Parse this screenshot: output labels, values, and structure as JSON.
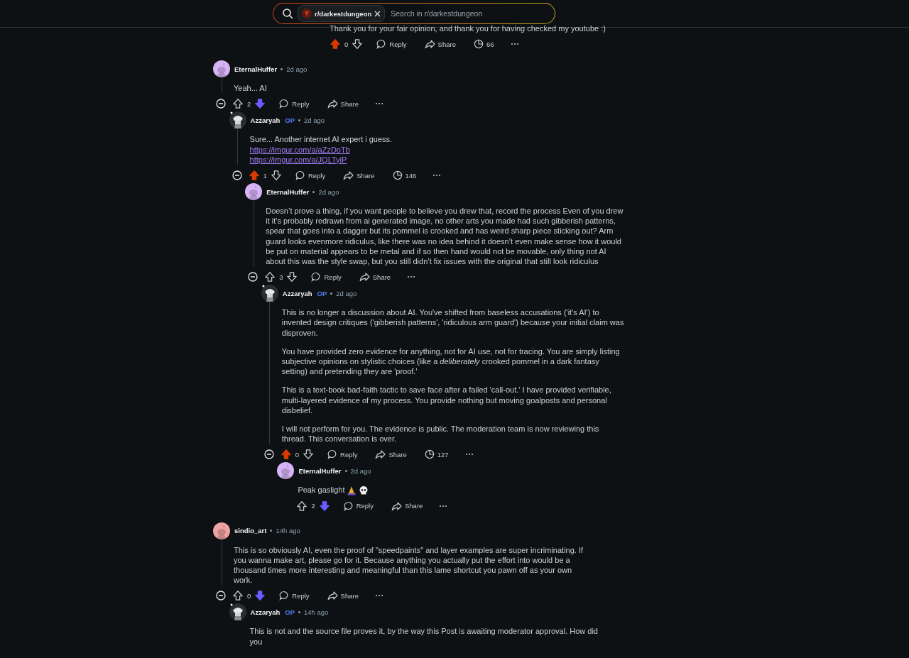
{
  "search": {
    "community": "r/darkestdungeon",
    "placeholder": "Search in r/darkestdungeon"
  },
  "fragment": {
    "body": [
      {
        "kind": "text",
        "text": "Thank you for your fair opinion, and thank you for having checked my youtube :)"
      }
    ],
    "upvoted": true,
    "downvoted": false,
    "score": "0",
    "reply_label": "Reply",
    "share_label": "Share",
    "views": "66"
  },
  "comments": [
    {
      "author": "EternalHuffer",
      "op": false,
      "time": "2d ago",
      "avatar": {
        "kind": "snoo",
        "color": "#d6b4f7"
      },
      "body": [
        {
          "kind": "text",
          "text": "Yeah... AI"
        }
      ],
      "upvoted": false,
      "downvoted": true,
      "score": "2",
      "reply_label": "Reply",
      "share_label": "Share",
      "children": [
        {
          "author": "Azzaryah",
          "op": true,
          "op_label": "OP",
          "time": "2d ago",
          "avatar": {
            "kind": "drawing"
          },
          "body": [
            {
              "kind": "text",
              "text": "Sure... Another internet AI expert i guess."
            },
            {
              "kind": "link",
              "text": "https://imgur.com/a/aZzDoTb"
            },
            {
              "kind": "link",
              "text": "https://imgur.com/a/JQLTyiP"
            }
          ],
          "upvoted": true,
          "downvoted": false,
          "score": "1",
          "reply_label": "Reply",
          "share_label": "Share",
          "views": "146",
          "children": [
            {
              "author": "EternalHuffer",
              "op": false,
              "time": "2d ago",
              "avatar": {
                "kind": "snoo",
                "color": "#d6b4f7"
              },
              "body": [
                {
                  "kind": "text",
                  "text": "Doesn’t prove a thing, if you want people to believe you drew that, record the process Even of you drew it it’s probably redrawn from ai generated image, no other arts you made had such gibberish patterns, spear that goes into a dagger but its pommel is crooked and has weird sharp piece sticking out? Arm guard looks evenmore ridiculus, like there was no idea behind it doesn’t even make sense how it would be put on material appears to be metal and if so then hand would not be movable, only thing not AI about this was the style swap, but you still didn’t fix issues with the original that still look ridiculus"
                }
              ],
              "upvoted": false,
              "downvoted": false,
              "score": "3",
              "reply_label": "Reply",
              "share_label": "Share",
              "children": [
                {
                  "author": "Azzaryah",
                  "op": true,
                  "op_label": "OP",
                  "time": "2d ago",
                  "avatar": {
                    "kind": "drawing"
                  },
                  "body": [
                    {
                      "kind": "text",
                      "text": "This is no longer a discussion about AI. You've shifted from baseless accusations ('it's AI') to invented design critiques ('gibberish patterns', 'ridiculous arm guard') because your initial claim was disproven."
                    },
                    {
                      "kind": "text",
                      "text": "You have provided zero evidence for anything, not for AI use, not for tracing. You are simply listing subjective opinions on stylistic choices (like a *deliberately* crooked pommel in a dark fantasy setting) and pretending they are 'proof.'"
                    },
                    {
                      "kind": "text",
                      "text": "This is a text-book bad-faith tactic to save face after a failed 'call-out.' I have provided verifiable, multi-layered evidence of my process. You provide nothing but moving goalposts and personal disbelief."
                    },
                    {
                      "kind": "text",
                      "text": "I will not perform for you. The evidence is public. The moderation team is now reviewing this thread. This conversation is over."
                    }
                  ],
                  "upvoted": true,
                  "downvoted": false,
                  "score": "0",
                  "reply_label": "Reply",
                  "share_label": "Share",
                  "views": "127",
                  "children": [
                    {
                      "author": "EternalHuffer",
                      "op": false,
                      "time": "2d ago",
                      "avatar": {
                        "kind": "snoo",
                        "color": "#d6b4f7"
                      },
                      "body": [
                        {
                          "kind": "text",
                          "text": "Peak gaslight",
                          "emojis": [
                            {
                              "kind": "pray"
                            },
                            {
                              "kind": "skull"
                            }
                          ]
                        }
                      ],
                      "upvoted": false,
                      "downvoted": true,
                      "score": "2",
                      "reply_label": "Reply",
                      "share_label": "Share"
                    }
                  ]
                }
              ]
            }
          ]
        }
      ]
    },
    {
      "author": "sindio_art",
      "op": false,
      "time": "14h ago",
      "avatar": {
        "kind": "snoo",
        "color": "#f0a3a3"
      },
      "body": [
        {
          "kind": "text",
          "text": "This is so obviously AI, even the proof of \"speedpaints\" and layer examples are super incriminating. If you wanna make art, please go for it. Because anything you actually put the effort into would be a thousand times more interesting and meaningful than this lame shortcut you pawn off as your own work."
        }
      ],
      "upvoted": false,
      "downvoted": true,
      "score": "0",
      "reply_label": "Reply",
      "share_label": "Share",
      "children": [
        {
          "author": "Azzaryah",
          "op": true,
          "op_label": "OP",
          "time": "14h ago",
          "avatar": {
            "kind": "drawing"
          },
          "body": [
            {
              "kind": "text",
              "text": "This is not and the source file proves it, by the way this Post is awaiting moderator approval. How did you"
            }
          ]
        }
      ]
    }
  ]
}
